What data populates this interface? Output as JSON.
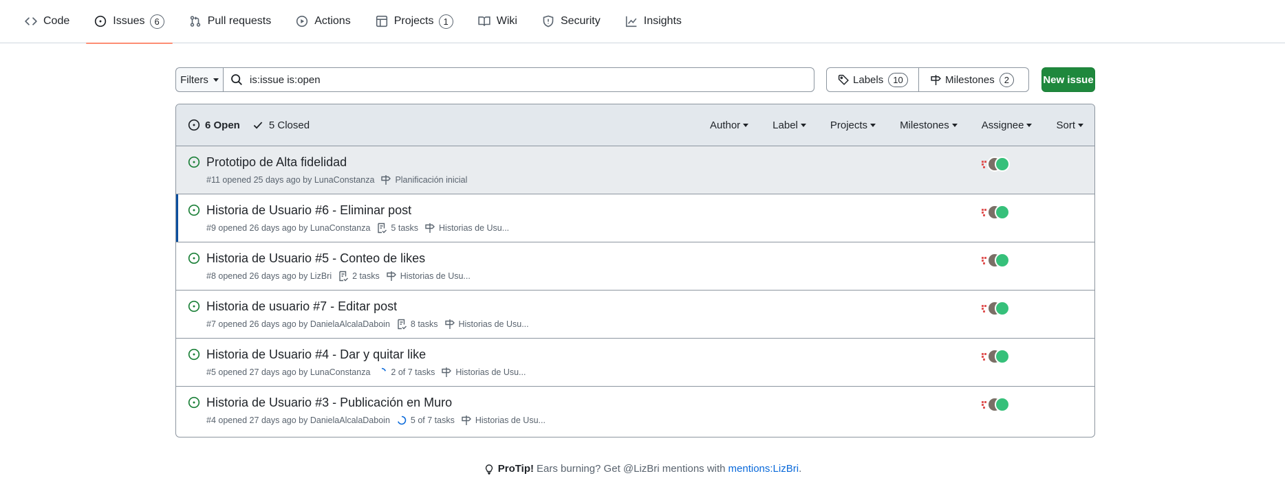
{
  "nav": {
    "items": [
      {
        "label": "Code",
        "icon": "code-icon"
      },
      {
        "label": "Issues",
        "icon": "issue-opened-icon",
        "count": "6",
        "active": true
      },
      {
        "label": "Pull requests",
        "icon": "git-pull-request-icon"
      },
      {
        "label": "Actions",
        "icon": "play-icon"
      },
      {
        "label": "Projects",
        "icon": "table-icon",
        "count": "1"
      },
      {
        "label": "Wiki",
        "icon": "book-icon"
      },
      {
        "label": "Security",
        "icon": "shield-icon"
      },
      {
        "label": "Insights",
        "icon": "graph-icon"
      }
    ]
  },
  "toolbar": {
    "filters_label": "Filters",
    "search_value": "is:issue is:open",
    "labels_label": "Labels",
    "labels_count": "10",
    "milestones_label": "Milestones",
    "milestones_count": "2",
    "new_issue_label": "New issue"
  },
  "list_header": {
    "open_label": "6 Open",
    "closed_label": "5 Closed",
    "filters": [
      "Author",
      "Label",
      "Projects",
      "Milestones",
      "Assignee",
      "Sort"
    ]
  },
  "issues": [
    {
      "title": "Prototipo de Alta fidelidad",
      "number_text": "#11 opened 25 days ago by",
      "author": "LunaConstanza",
      "tasks": "",
      "milestone": "Planificación inicial"
    },
    {
      "title": "Historia de Usuario #6 - Eliminar post",
      "number_text": "#9 opened 26 days ago by",
      "author": "LunaConstanza",
      "tasks": "5 tasks",
      "milestone": "Historias de Usu..."
    },
    {
      "title": "Historia de Usuario #5 - Conteo de likes",
      "number_text": "#8 opened 26 days ago by",
      "author": "LizBri",
      "tasks": "2 tasks",
      "milestone": "Historias de Usu..."
    },
    {
      "title": "Historia de usuario #7 - Editar post",
      "number_text": "#7 opened 26 days ago by",
      "author": "DanielaAlcalaDaboin",
      "tasks": "8 tasks",
      "milestone": "Historias de Usu..."
    },
    {
      "title": "Historia de Usuario #4 - Dar y quitar like",
      "number_text": "#5 opened 27 days ago by",
      "author": "LunaConstanza",
      "tasks": "2 of 7 tasks",
      "milestone": "Historias de Usu..."
    },
    {
      "title": "Historia de Usuario #3 - Publicación en Muro",
      "number_text": "#4 opened 27 days ago by",
      "author": "DanielaAlcalaDaboin",
      "tasks": "5 of 7 tasks",
      "milestone": "Historias de Usu..."
    }
  ],
  "protip": {
    "strong": "ProTip!",
    "text": "Ears burning? Get @LizBri mentions with",
    "link": "mentions:LizBri",
    "suffix": "."
  },
  "colors": {
    "open_green": "#1a7f37",
    "primary_button": "#1f883d",
    "active_underline": "#fd8c73",
    "link": "#0969da"
  }
}
